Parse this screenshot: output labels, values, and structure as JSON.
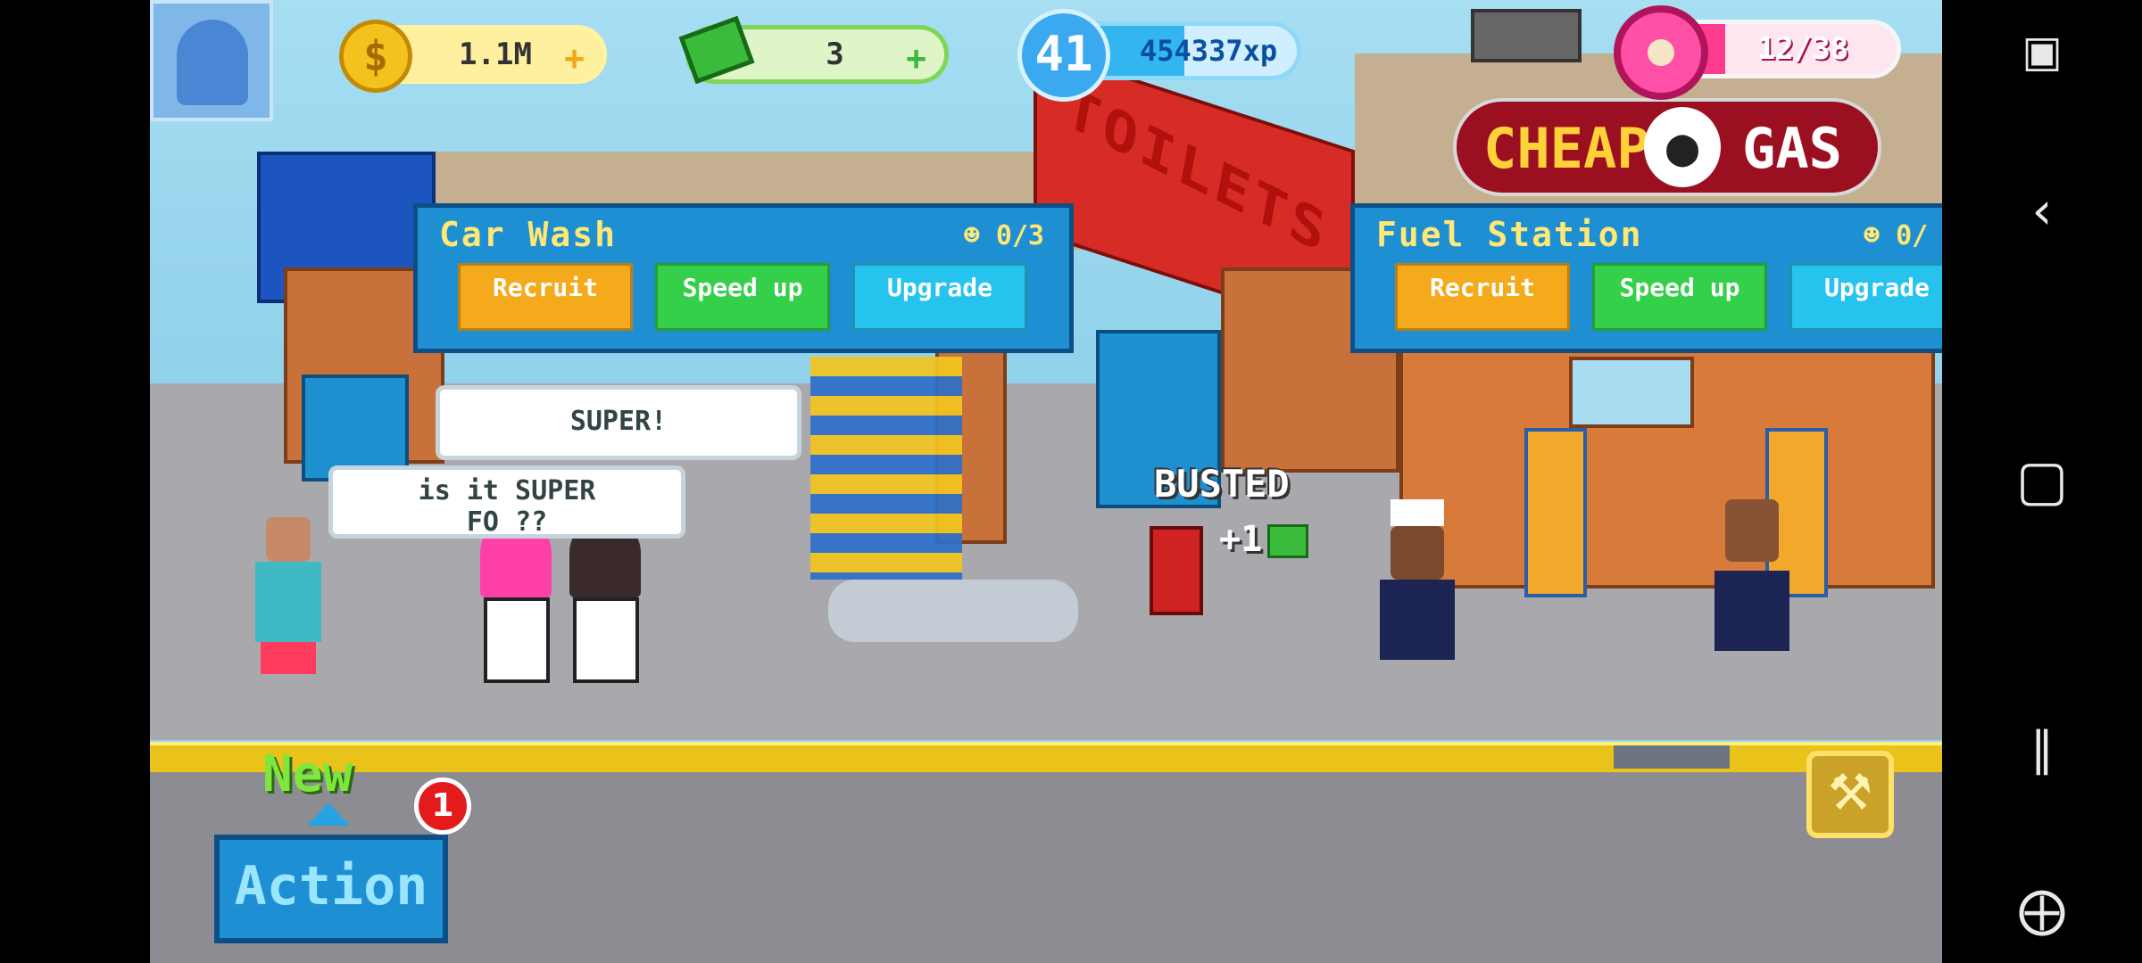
{
  "hud": {
    "cash": "1.1M",
    "bills": "3",
    "level": "41",
    "xp": "454337xp",
    "donuts": "12/38",
    "plus": "+",
    "coin_symbol": "$"
  },
  "signs": {
    "toilets": "TOILETS",
    "cheap": "CHEAP",
    "gas": "GAS"
  },
  "panels": [
    {
      "title": "Car Wash",
      "count": "0/3",
      "recruit": "Recruit",
      "speed": "Speed up",
      "upgrade": "Upgrade"
    },
    {
      "title": "Fuel Station",
      "count": "0/",
      "recruit": "Recruit",
      "speed": "Speed up",
      "upgrade": "Upgrade"
    }
  ],
  "bubbles": {
    "super": "SUPER!",
    "question_line1": "is it SUPER",
    "question_line2": "FO  ??"
  },
  "floating": {
    "busted": "BUSTED",
    "plus_one": "+1"
  },
  "action": {
    "new_label": "New",
    "badge": "1",
    "label": "Action"
  },
  "colors": {
    "recruit": "#f5aa1c",
    "speed": "#35d04a",
    "upgrade": "#27c3ef",
    "panel": "#1f8fd4",
    "curb": "#e9c21a"
  },
  "progress": {
    "xp_fraction": 0.55,
    "donut_fraction": 0.316
  }
}
